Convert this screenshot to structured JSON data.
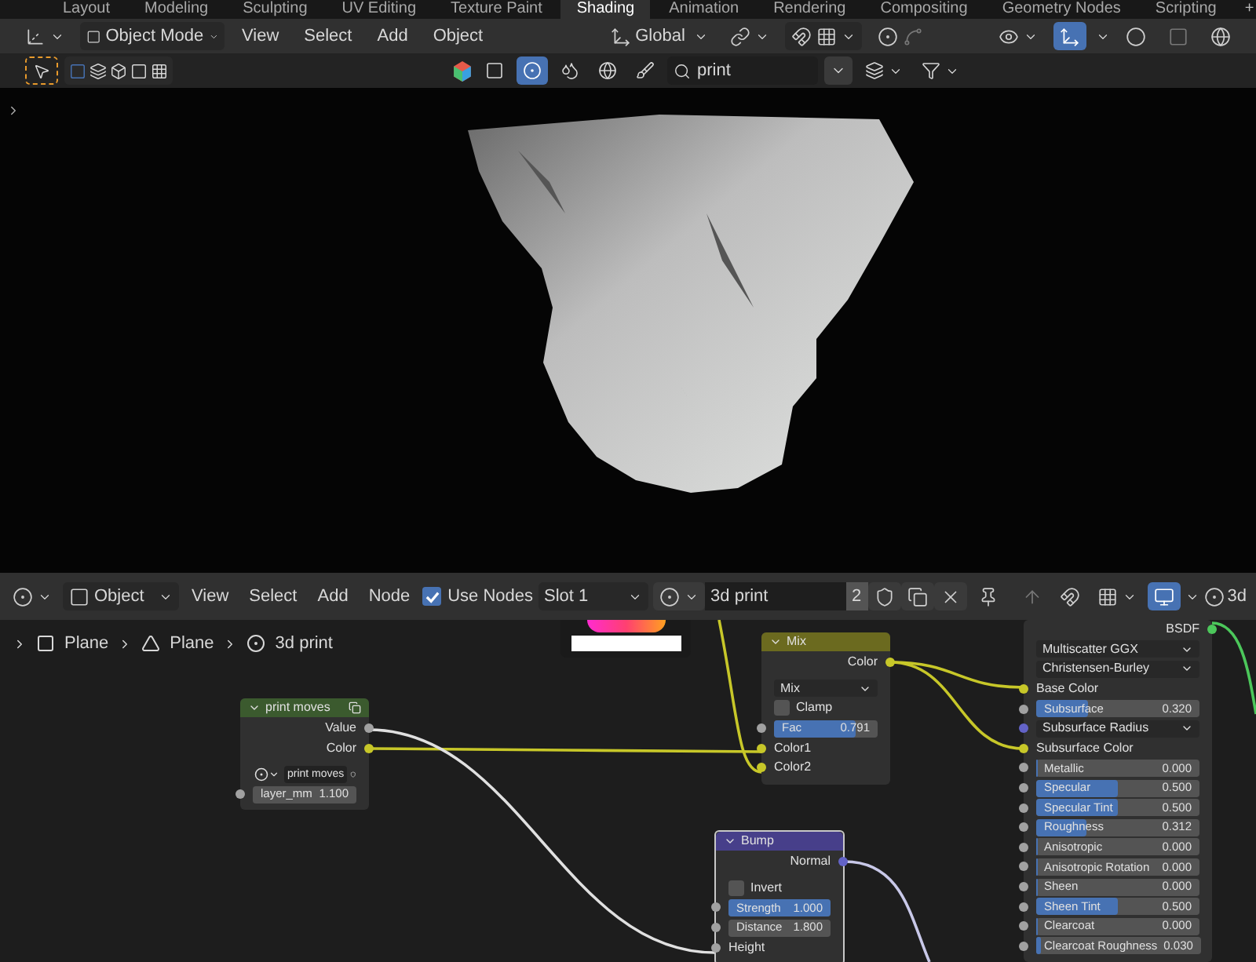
{
  "workspace_tabs": [
    {
      "label": "Layout",
      "selected": false
    },
    {
      "label": "Modeling",
      "selected": false
    },
    {
      "label": "Sculpting",
      "selected": false
    },
    {
      "label": "UV Editing",
      "selected": false
    },
    {
      "label": "Texture Paint",
      "selected": false
    },
    {
      "label": "Shading",
      "selected": true
    },
    {
      "label": "Animation",
      "selected": false
    },
    {
      "label": "Rendering",
      "selected": false
    },
    {
      "label": "Compositing",
      "selected": false
    },
    {
      "label": "Geometry Nodes",
      "selected": false
    },
    {
      "label": "Scripting",
      "selected": false
    }
  ],
  "add_tab": "+",
  "viewport_header": {
    "mode": "Object Mode",
    "menus": [
      "View",
      "Select",
      "Add",
      "Object"
    ],
    "orientation": "Global"
  },
  "viewport_toolbar": {
    "search_value": "print"
  },
  "node_header": {
    "mode": "Object",
    "menus": [
      "View",
      "Select",
      "Add",
      "Node"
    ],
    "use_nodes": {
      "label": "Use Nodes",
      "checked": true
    },
    "slot": "Slot 1",
    "material": "3d print",
    "users": "2",
    "cut_label": "3d"
  },
  "breadcrumbs": [
    {
      "label": "Plane",
      "kind": "object"
    },
    {
      "label": "Plane",
      "kind": "mesh"
    },
    {
      "label": "3d print",
      "kind": "material"
    }
  ],
  "nodes": [
    {
      "kind": "group",
      "title": "print moves",
      "color": "#3b5a2e",
      "rows": [
        {
          "kind": "output",
          "label": "Value",
          "color": "#a1a1a1"
        },
        {
          "kind": "output",
          "label": "Color",
          "color": "#c7c729"
        },
        {
          "kind": "datablock",
          "value": "print moves"
        },
        {
          "kind": "field",
          "label": "layer_mm",
          "value": "1.100",
          "color": "#a1a1a1"
        }
      ]
    },
    {
      "kind": "mix",
      "title": "Mix",
      "color": "#6b6a1f",
      "rows": [
        {
          "kind": "output",
          "label": "Color",
          "color": "#c7c729"
        },
        {
          "kind": "dropdown",
          "value": "Mix"
        },
        {
          "kind": "checkbox",
          "label": "Clamp",
          "checked": false
        },
        {
          "kind": "slider",
          "label": "Fac",
          "value": "0.791",
          "level": 0.791,
          "color": "#a1a1a1"
        },
        {
          "kind": "input",
          "label": "Color1",
          "color": "#c7c729"
        },
        {
          "kind": "input",
          "label": "Color2",
          "color": "#c7c729"
        }
      ]
    },
    {
      "kind": "bump",
      "title": "Bump",
      "color": "#473f8a",
      "rows": [
        {
          "kind": "output",
          "label": "Normal",
          "color": "#6363c7"
        },
        {
          "kind": "checkbox",
          "label": "Invert",
          "checked": false
        },
        {
          "kind": "slider",
          "label": "Strength",
          "value": "1.000",
          "level": 1,
          "color": "#a1a1a1"
        },
        {
          "kind": "field",
          "label": "Distance",
          "value": "1.800",
          "color": "#a1a1a1"
        },
        {
          "kind": "input",
          "label": "Height",
          "color": "#a1a1a1"
        }
      ]
    },
    {
      "kind": "bsdf",
      "rows": [
        {
          "kind": "output",
          "label": "BSDF",
          "color": "#4cc75b"
        },
        {
          "kind": "dropdown",
          "value": "Multiscatter GGX"
        },
        {
          "kind": "dropdown",
          "value": "Christensen-Burley"
        },
        {
          "kind": "input",
          "label": "Base Color",
          "color": "#c7c729"
        },
        {
          "kind": "slider",
          "label": "Subsurface",
          "value": "0.320",
          "level": 0.32,
          "color": "#a1a1a1"
        },
        {
          "kind": "dropdown",
          "value": "Subsurface Radius",
          "color": "#6363c7"
        },
        {
          "kind": "input",
          "label": "Subsurface Color",
          "color": "#c7c729"
        },
        {
          "kind": "slider",
          "label": "Metallic",
          "value": "0.000",
          "level": 0,
          "color": "#a1a1a1"
        },
        {
          "kind": "slider",
          "label": "Specular",
          "value": "0.500",
          "level": 0.5,
          "color": "#a1a1a1"
        },
        {
          "kind": "slider",
          "label": "Specular Tint",
          "value": "0.500",
          "level": 0.5,
          "color": "#a1a1a1"
        },
        {
          "kind": "slider",
          "label": "Roughness",
          "value": "0.312",
          "level": 0.312,
          "color": "#a1a1a1"
        },
        {
          "kind": "slider",
          "label": "Anisotropic",
          "value": "0.000",
          "level": 0,
          "color": "#a1a1a1"
        },
        {
          "kind": "slider",
          "label": "Anisotropic Rotation",
          "value": "0.000",
          "level": 0,
          "color": "#a1a1a1"
        },
        {
          "kind": "slider",
          "label": "Sheen",
          "value": "0.000",
          "level": 0,
          "color": "#a1a1a1"
        },
        {
          "kind": "slider",
          "label": "Sheen Tint",
          "value": "0.500",
          "level": 0.5,
          "color": "#a1a1a1"
        },
        {
          "kind": "slider",
          "label": "Clearcoat",
          "value": "0.000",
          "level": 0,
          "color": "#a1a1a1"
        },
        {
          "kind": "slider",
          "label": "Clearcoat Roughness",
          "value": "0.030",
          "level": 0.03,
          "color": "#a1a1a1"
        }
      ]
    }
  ]
}
